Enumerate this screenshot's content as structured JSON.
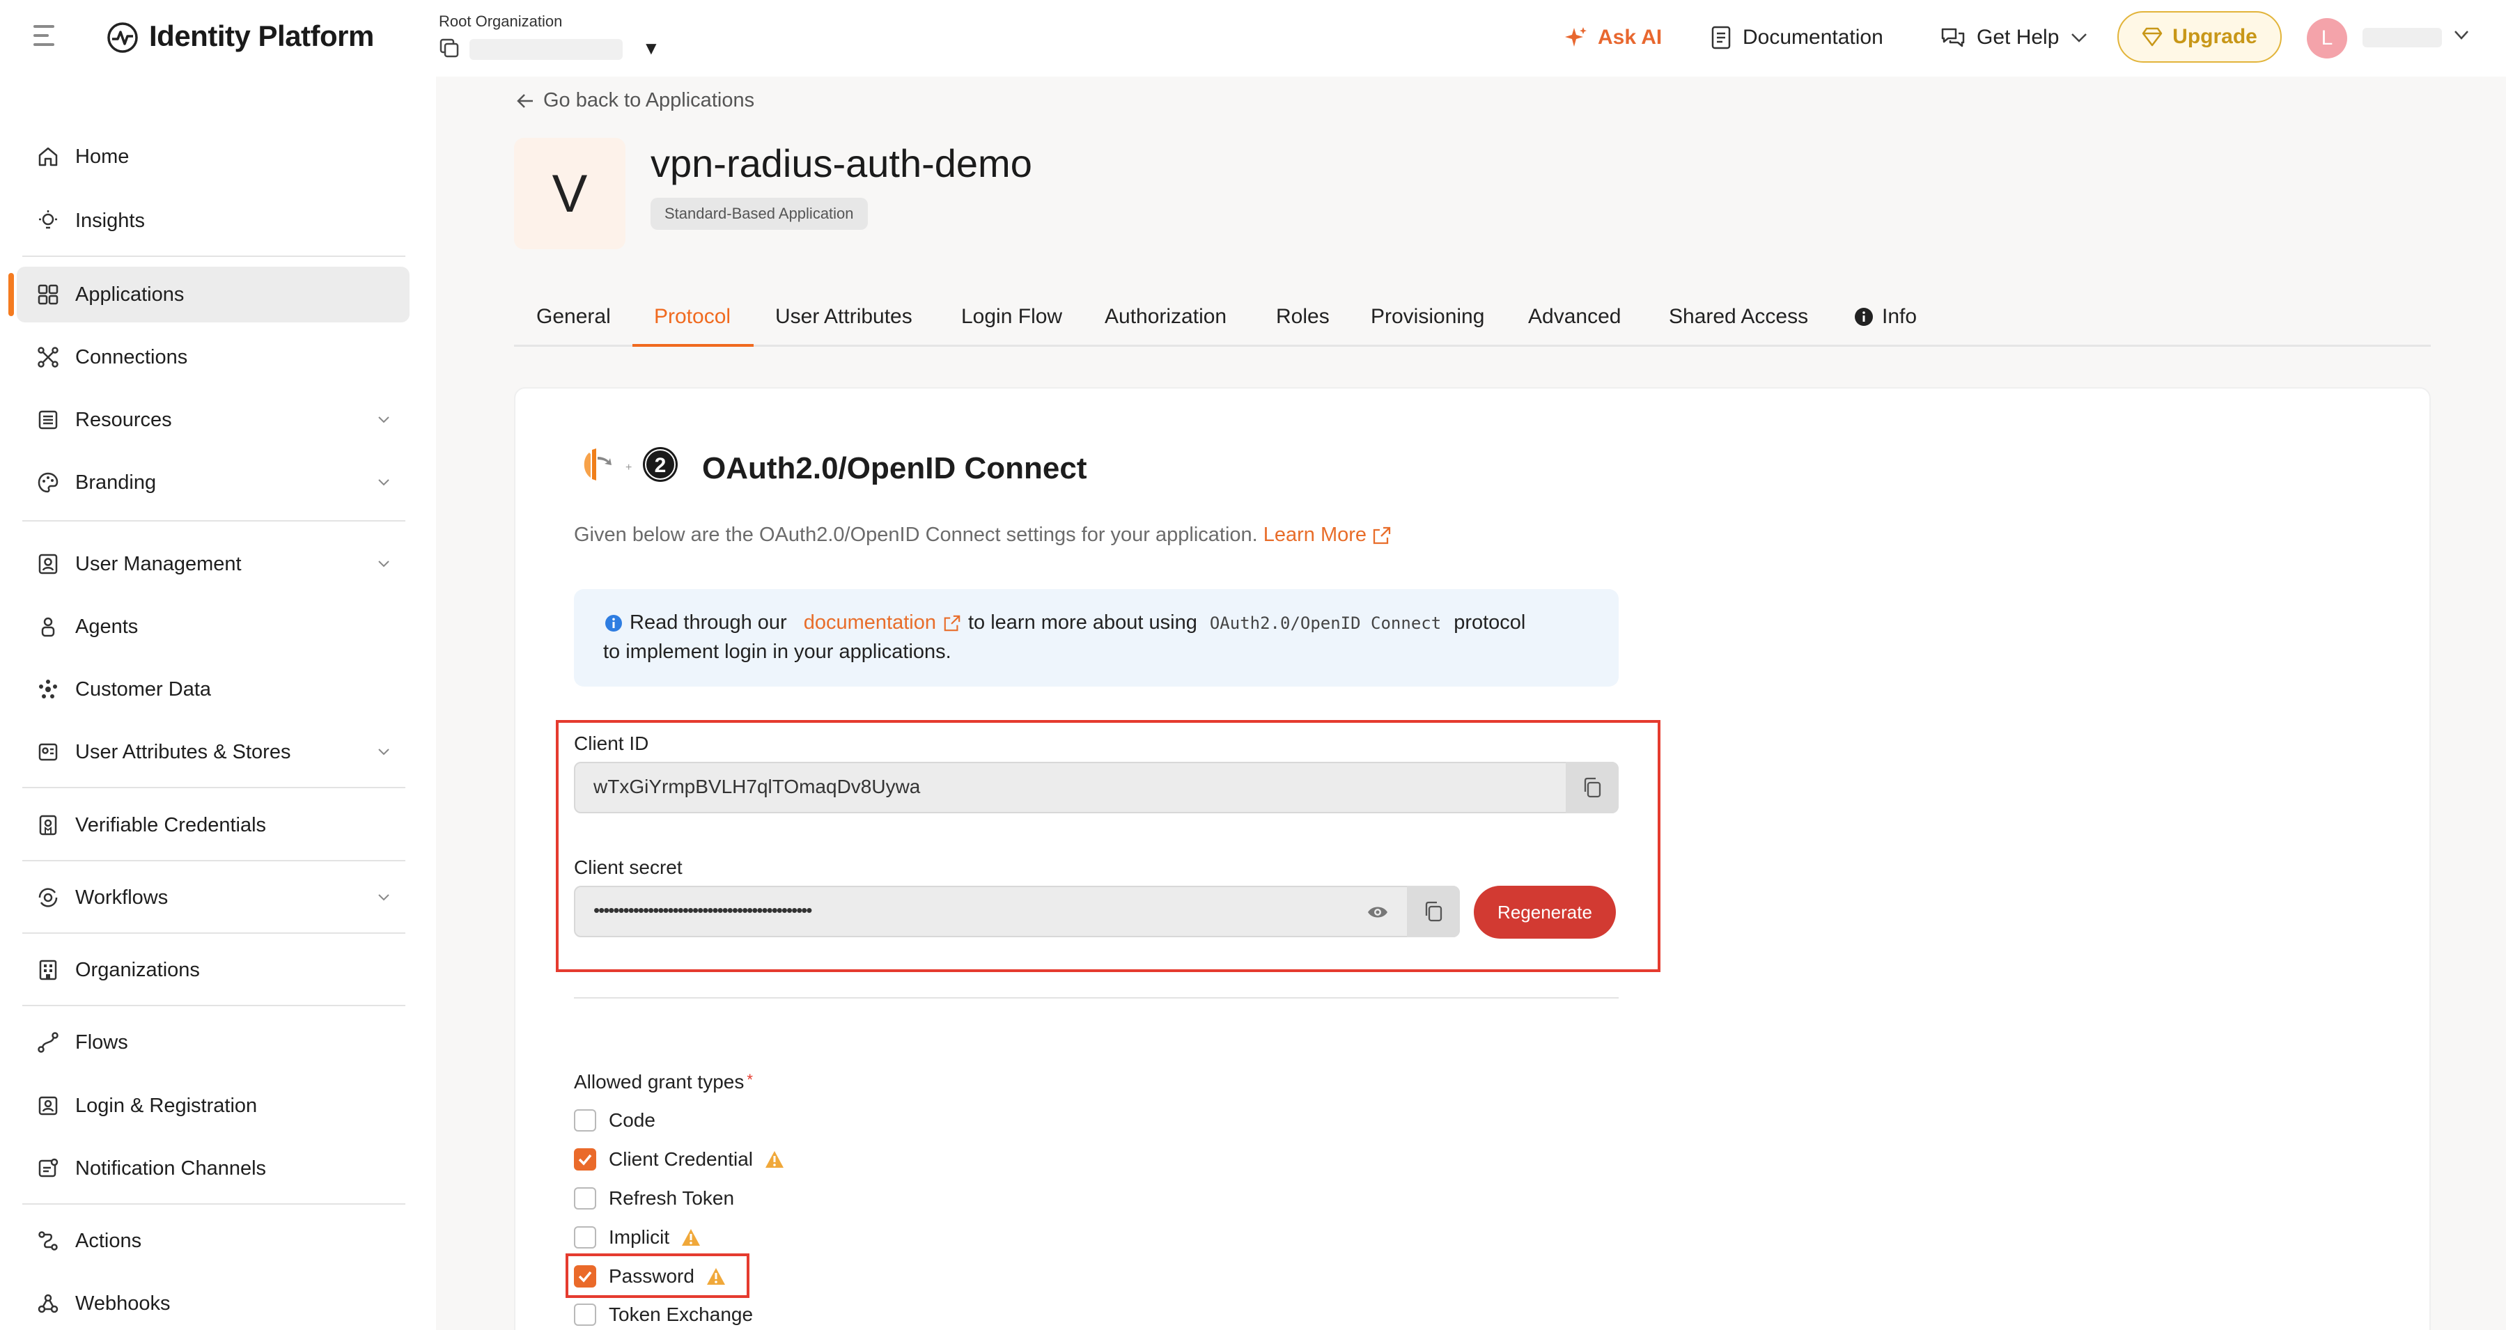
{
  "header": {
    "brand": "Identity Platform",
    "org_label": "Root Organization",
    "ask_ai": "Ask AI",
    "documentation": "Documentation",
    "get_help": "Get Help",
    "upgrade": "Upgrade",
    "avatar_initial": "L"
  },
  "sidebar": {
    "items": [
      {
        "label": "Home",
        "icon": "home-icon"
      },
      {
        "label": "Insights",
        "icon": "lightbulb-icon"
      },
      {
        "label": "Applications",
        "icon": "grid-icon",
        "active": true
      },
      {
        "label": "Connections",
        "icon": "connections-icon"
      },
      {
        "label": "Resources",
        "icon": "resources-icon",
        "expandable": true
      },
      {
        "label": "Branding",
        "icon": "palette-icon",
        "expandable": true
      },
      {
        "label": "User Management",
        "icon": "user-card-icon",
        "expandable": true
      },
      {
        "label": "Agents",
        "icon": "agent-icon"
      },
      {
        "label": "Customer Data",
        "icon": "customer-data-icon"
      },
      {
        "label": "User Attributes & Stores",
        "icon": "attributes-icon",
        "expandable": true
      },
      {
        "label": "Verifiable Credentials",
        "icon": "credential-icon"
      },
      {
        "label": "Workflows",
        "icon": "workflow-icon",
        "expandable": true
      },
      {
        "label": "Organizations",
        "icon": "building-icon"
      },
      {
        "label": "Flows",
        "icon": "flow-icon"
      },
      {
        "label": "Login & Registration",
        "icon": "login-icon"
      },
      {
        "label": "Notification Channels",
        "icon": "notification-icon"
      },
      {
        "label": "Actions",
        "icon": "actions-icon"
      },
      {
        "label": "Webhooks",
        "icon": "webhook-icon"
      }
    ]
  },
  "page": {
    "back_link": "Go back to Applications",
    "app_initial": "V",
    "app_name": "vpn-radius-auth-demo",
    "app_type": "Standard-Based Application"
  },
  "tabs": [
    "General",
    "Protocol",
    "User Attributes",
    "Login Flow",
    "Authorization",
    "Roles",
    "Provisioning",
    "Advanced",
    "Shared Access",
    "Info"
  ],
  "active_tab": "Protocol",
  "protocol": {
    "title": "OAuth2.0/OpenID Connect",
    "description": "Given below are the OAuth2.0/OpenID Connect settings for your application.",
    "learn_more": "Learn More",
    "info_read": "Read through our",
    "info_doc": "documentation",
    "info_mid": "to learn more about using",
    "info_code": "OAuth2.0/OpenID Connect",
    "info_end": "protocol",
    "info_line2": "to implement login in your applications."
  },
  "credentials": {
    "client_id_label": "Client ID",
    "client_id_value": "wTxGiYrmpBVLH7qlTOmaqDv8Uywa",
    "client_secret_label": "Client secret",
    "client_secret_value": "••••••••••••••••••••••••••••••••••••••••••••",
    "regenerate": "Regenerate"
  },
  "grants": {
    "label": "Allowed grant types",
    "required_mark": "*",
    "items": [
      {
        "label": "Code",
        "checked": false,
        "warning": false
      },
      {
        "label": "Client Credential",
        "checked": true,
        "warning": true
      },
      {
        "label": "Refresh Token",
        "checked": false,
        "warning": false
      },
      {
        "label": "Implicit",
        "checked": false,
        "warning": true
      },
      {
        "label": "Password",
        "checked": true,
        "warning": true
      },
      {
        "label": "Token Exchange",
        "checked": false,
        "warning": false
      }
    ]
  },
  "colors": {
    "accent": "#f06a1f",
    "regenerate": "#d23a32",
    "highlight_frame": "#e53b2f",
    "upgrade": "#c89718"
  }
}
